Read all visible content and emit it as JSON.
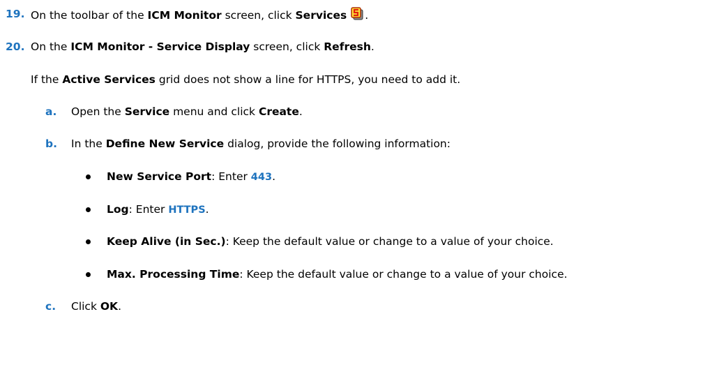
{
  "colors": {
    "step_number": "#1e73be",
    "code_value": "#1e73be",
    "text": "#000000"
  },
  "icons": {
    "services": "services-toolbar-icon"
  },
  "steps": [
    {
      "number": "19.",
      "parts": [
        "On the toolbar of the ",
        "ICM Monitor",
        " screen, click ",
        "Services",
        "."
      ]
    },
    {
      "number": "20.",
      "parts": [
        "On the ",
        "ICM Monitor - Service Display",
        " screen, click ",
        "Refresh",
        "."
      ]
    }
  ],
  "note": {
    "parts": [
      "If the ",
      "Active Services",
      " grid does not show a line for HTTPS, you need to add it."
    ]
  },
  "substeps": [
    {
      "letter": "a.",
      "parts": [
        "Open the ",
        "Service",
        " menu and click ",
        "Create",
        "."
      ]
    },
    {
      "letter": "b.",
      "parts": [
        "In the ",
        "Define New Service",
        " dialog, provide the following information:"
      ]
    },
    {
      "letter": "c.",
      "parts": [
        "Click ",
        "OK",
        "."
      ]
    }
  ],
  "bullets": [
    {
      "label": "New Service Port",
      "text": ": Enter ",
      "value": "443",
      "end": "."
    },
    {
      "label": "Log",
      "text": ": Enter ",
      "value": "HTTPS",
      "end": "."
    },
    {
      "label": "Keep Alive (in Sec.)",
      "text": ": Keep the default value or change to a value of your choice.",
      "value": "",
      "end": ""
    },
    {
      "label": "Max. Processing Time",
      "text": ": Keep the default value or change to a value of your choice.",
      "value": "",
      "end": ""
    }
  ]
}
